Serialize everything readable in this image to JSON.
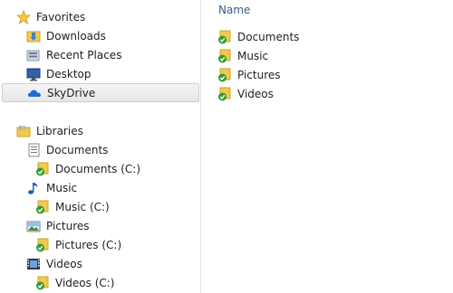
{
  "navigation": {
    "favorites": {
      "label": "Favorites",
      "icon": "star-icon",
      "items": [
        {
          "label": "Downloads",
          "icon": "downloads-folder-icon"
        },
        {
          "label": "Recent Places",
          "icon": "recent-places-icon"
        },
        {
          "label": "Desktop",
          "icon": "desktop-icon"
        },
        {
          "label": "SkyDrive",
          "icon": "skydrive-cloud-icon",
          "selected": true
        }
      ]
    },
    "libraries": {
      "label": "Libraries",
      "icon": "libraries-icon",
      "items": [
        {
          "label": "Documents",
          "icon": "documents-library-icon",
          "sub": "Documents (C:)"
        },
        {
          "label": "Music",
          "icon": "music-note-icon",
          "sub": "Music (C:)"
        },
        {
          "label": "Pictures",
          "icon": "pictures-library-icon",
          "sub": "Pictures (C:)"
        },
        {
          "label": "Videos",
          "icon": "videos-library-icon",
          "sub": "Videos (C:)"
        }
      ]
    }
  },
  "content": {
    "column_header": "Name",
    "items": [
      {
        "label": "Documents",
        "icon": "synced-folder-icon"
      },
      {
        "label": "Music",
        "icon": "synced-folder-icon"
      },
      {
        "label": "Pictures",
        "icon": "synced-folder-icon"
      },
      {
        "label": "Videos",
        "icon": "synced-folder-icon"
      }
    ]
  },
  "colors": {
    "selection_bg": "#e6e6e6",
    "header_text": "#3a5a8c",
    "folder_yellow": "#f2c94c",
    "sync_green": "#2e9e2e"
  }
}
